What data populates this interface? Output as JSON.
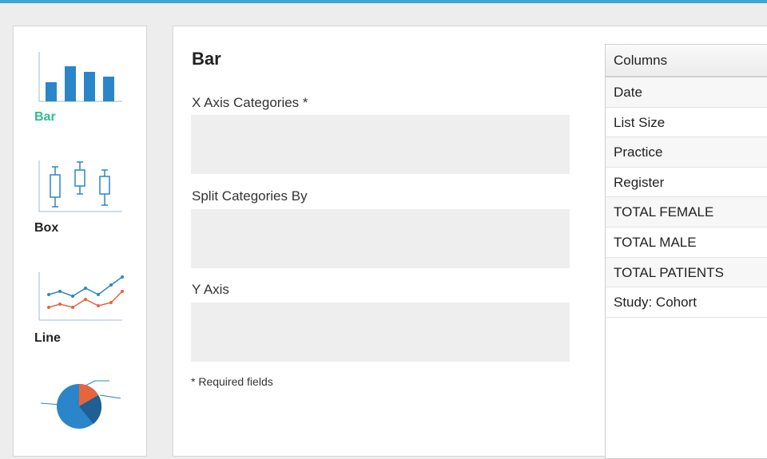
{
  "chart_types": [
    {
      "label": "Bar",
      "icon": "bar-chart-icon",
      "selected": true
    },
    {
      "label": "Box",
      "icon": "box-plot-icon",
      "selected": false
    },
    {
      "label": "Line",
      "icon": "line-chart-icon",
      "selected": false
    },
    {
      "label": "",
      "icon": "pie-chart-icon",
      "selected": false
    }
  ],
  "panel": {
    "title": "Bar",
    "x_axis_label": "X Axis Categories *",
    "split_label": "Split Categories By",
    "y_axis_label": "Y Axis",
    "required_note": "* Required fields"
  },
  "columns": {
    "header": "Columns",
    "items": [
      "Date",
      "List Size",
      "Practice",
      "Register",
      "TOTAL FEMALE",
      "TOTAL MALE",
      "TOTAL PATIENTS",
      "Study: Cohort"
    ]
  },
  "colors": {
    "accent": "#3aa6d8",
    "selected_label": "#2bbf8f",
    "chart_blue": "#2b86c9",
    "chart_orange": "#e8643a"
  }
}
